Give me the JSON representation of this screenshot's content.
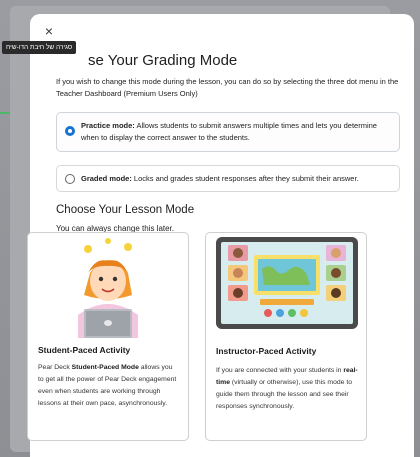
{
  "tooltip": "סגירה של חיבת הדו-שיח",
  "close_label": "×",
  "grading": {
    "title": "se Your Grading Mode",
    "intro": "If you wish to change this mode during the lesson, you can do so by selecting the three dot menu in the Teacher Dashboard (Premium Users Only)",
    "practice": {
      "label": "Practice mode:",
      "text": " Allows students to submit answers multiple times and lets you determine when to display the correct answer to the students.",
      "selected": true
    },
    "graded": {
      "label": "Graded mode:",
      "text": " Locks and grades student responses after they submit their answer.",
      "selected": false
    }
  },
  "lesson": {
    "title": "Choose Your Lesson Mode",
    "subtitle": "You can always change this later."
  },
  "student_paced": {
    "title": "Student-Paced Activity",
    "desc_pre": "Pear Deck ",
    "desc_bold": "Student-Paced Mode",
    "desc_post": " allows you to get all the power of Pear Deck engagement even when students are working through lessons at their own pace, asynchronously."
  },
  "instructor_paced": {
    "title": "Instructor-Paced Activity",
    "desc_pre": "If you are connected with your students in ",
    "desc_bold": "real-time",
    "desc_post": " (virtually or otherwise), use this mode to guide them through the lesson and see their responses synchronously."
  },
  "colors": {
    "accent": "#1673d4",
    "backdrop": "#8f9196"
  }
}
